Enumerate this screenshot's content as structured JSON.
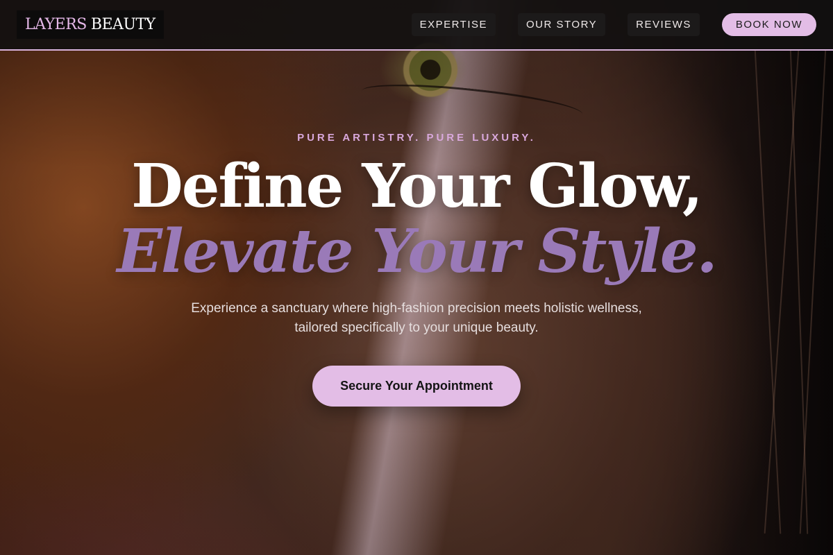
{
  "brand": {
    "logo_part1": "LAYERS",
    "logo_part2": "BEAUTY",
    "accent_color": "#e3bde6",
    "accent_dark": "#9a7ab8"
  },
  "nav": {
    "items": [
      {
        "label": "EXPERTISE"
      },
      {
        "label": "OUR STORY"
      },
      {
        "label": "REVIEWS"
      }
    ],
    "book_label": "BOOK NOW"
  },
  "hero": {
    "eyebrow": "PURE ARTISTRY. PURE LUXURY.",
    "title_line1": "Define Your Glow,",
    "title_line2": "Elevate Your Style.",
    "subtitle": "Experience a sanctuary where high-fashion precision meets holistic wellness, tailored specifically to your unique beauty.",
    "cta_label": "Secure Your Appointment"
  }
}
